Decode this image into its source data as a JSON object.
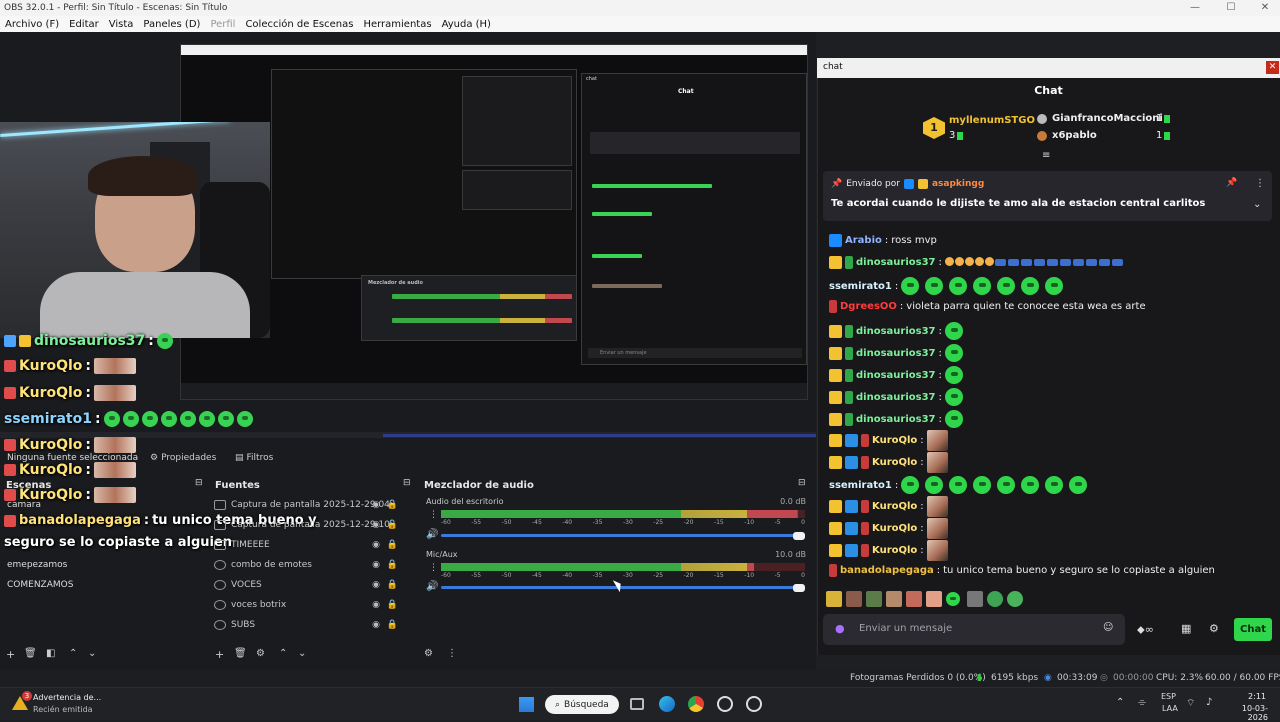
{
  "window": {
    "title": "OBS 32.0.1 - Perfil: Sin Título - Escenas: Sin Título",
    "controls": [
      "—",
      "☐",
      "✕"
    ]
  },
  "menu": [
    "Archivo (F)",
    "Editar",
    "Vista",
    "Paneles (D)",
    "Perfil",
    "Colección de Escenas",
    "Herramientas",
    "Ayuda (H)"
  ],
  "preview": {
    "nested_chat_title": "chat",
    "nested_chat_header": "Chat",
    "nested_mixer_title": "Mezclador de audio",
    "nested_placeholder": "Enviar un mensaje"
  },
  "overlay_chat": [
    {
      "name": "dinosaurios37",
      "sep": ":"
    },
    {
      "name": "KuroQlo",
      "sep": ":"
    },
    {
      "name": "KuroQlo",
      "sep": ":"
    },
    {
      "name": "ssemirato1",
      "sep": ":"
    },
    {
      "name": "KuroQlo",
      "sep": ":"
    },
    {
      "name": "KuroQlo",
      "sep": ":"
    },
    {
      "name": "KuroQlo",
      "sep": ":"
    },
    {
      "name": "banadolapegaga",
      "sep": ":",
      "msg1": "tu unico tema bueno y",
      "msg2": "seguro se lo copiaste a alguien"
    }
  ],
  "context": {
    "no_source": "Ninguna fuente seleccionada",
    "properties": "Propiedades",
    "filters": "Filtros"
  },
  "scenes": {
    "title": "Escenas",
    "items": [
      "camara",
      "emepezamos",
      "COMENZAMOS"
    ]
  },
  "sources": {
    "title": "Fuentes",
    "items": [
      "Captura de pantalla 2025-12-29 04:",
      "Captura de pantalla 2025-12-29 10:",
      "TIMEEEE",
      "combo de emotes",
      "VOCES",
      "voces botrix",
      "SUBS"
    ]
  },
  "mixer": {
    "title": "Mezclador de audio",
    "channels": [
      {
        "name": "Audio del escritorio",
        "db": "0.0 dB",
        "level": 0.98
      },
      {
        "name": "Mic/Aux",
        "db": "10.0 dB",
        "level": 0.86
      }
    ],
    "scale": [
      "-60",
      "-55",
      "-50",
      "-45",
      "-40",
      "-35",
      "-30",
      "-25",
      "-20",
      "-15",
      "-10",
      "-5",
      "0"
    ]
  },
  "status": {
    "dropped": "Fotogramas Perdidos 0 (0.0%)",
    "bitrate": "6195 kbps",
    "stream_time": "00:33:09",
    "rec_time": "00:00:00",
    "cpu": "CPU: 2.3%",
    "fps": "60.00 / 60.00 FPS"
  },
  "taskbar": {
    "notification_title": "Advertencia de...",
    "notification_sub": "Recién emitida",
    "notification_count": "3",
    "search": "Búsqueda",
    "lang": "ESP",
    "layout": "LAA",
    "time": "2:11",
    "date": "10-03-2026"
  },
  "chat": {
    "window_title": "chat",
    "header": "Chat",
    "leaderboard": [
      {
        "rank": "1",
        "name": "myllenumSTGO",
        "count": "3"
      },
      {
        "rank": "",
        "name": "GianfrancoMaccioni",
        "count": "1"
      },
      {
        "rank": "",
        "name": "x6pablo",
        "count": "1"
      }
    ],
    "pinned_label": "Enviado por",
    "pinned_user": "asapkingg",
    "pinned_msg": "Te acordai cuando le dijiste te amo ala de estacion central carlitos",
    "messages": [
      {
        "name": "Arabio",
        "msg": "ross mvp",
        "color": "#8fb3ff"
      },
      {
        "name": "dinosaurios37",
        "msg": "",
        "color": "#7cf09a"
      },
      {
        "name": "ssemirato1",
        "msg": "",
        "color": "#d6f2ff"
      },
      {
        "name": "DgreesOO",
        "msg": "violeta parra quien te conocee esta wea es arte",
        "color": "#ff3b3b"
      },
      {
        "name": "dinosaurios37",
        "msg": "",
        "color": "#7cf09a"
      },
      {
        "name": "dinosaurios37",
        "msg": "",
        "color": "#7cf09a"
      },
      {
        "name": "dinosaurios37",
        "msg": "",
        "color": "#7cf09a"
      },
      {
        "name": "dinosaurios37",
        "msg": "",
        "color": "#7cf09a"
      },
      {
        "name": "dinosaurios37",
        "msg": "",
        "color": "#7cf09a"
      },
      {
        "name": "KuroQlo",
        "msg": "",
        "color": "#ffe27a"
      },
      {
        "name": "KuroQlo",
        "msg": "",
        "color": "#ffe27a"
      },
      {
        "name": "ssemirato1",
        "msg": "",
        "color": "#d6f2ff"
      },
      {
        "name": "KuroQlo",
        "msg": "",
        "color": "#ffe27a"
      },
      {
        "name": "KuroQlo",
        "msg": "",
        "color": "#ffe27a"
      },
      {
        "name": "KuroQlo",
        "msg": "",
        "color": "#ffe27a"
      },
      {
        "name": "banadolapegaga",
        "msg": "tu unico tema bueno y seguro se lo copiaste a alguien",
        "color": "#f0c040"
      }
    ],
    "input_placeholder": "Enviar un mensaje",
    "send_button": "Chat",
    "accent": "#2fd64b"
  }
}
